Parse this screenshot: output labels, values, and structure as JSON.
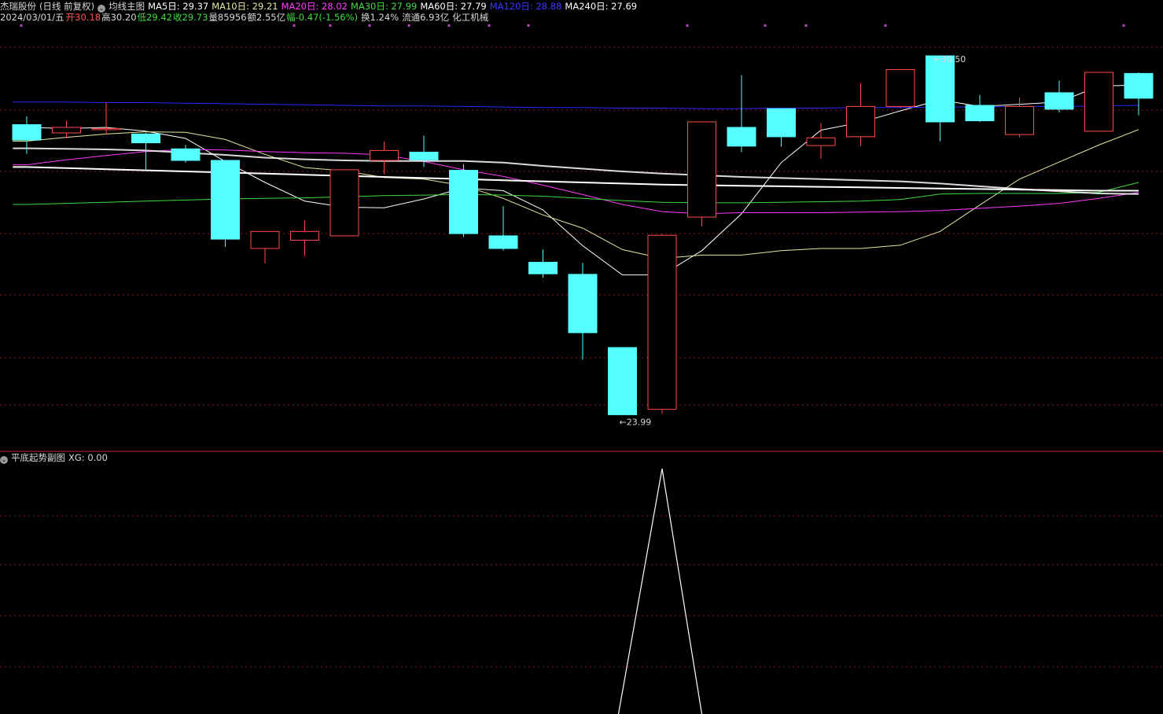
{
  "header": {
    "stock_name": "杰瑞股份",
    "period_mode": "(日线 前复权)",
    "main_indicator": "均线主图",
    "ma5": "MA5日: 29.37",
    "ma10": "MA10日: 29.21",
    "ma20": "MA20日: 28.02",
    "ma30": "MA30日: 27.99",
    "ma60": "MA60日: 27.79",
    "ma120": "MA120日: 28.88",
    "ma240": "MA240日: 27.69"
  },
  "quote": {
    "date": "2024/03/01/五",
    "open": "开30.18",
    "high": "高30.20",
    "low": "低29.42",
    "close": "收29.73",
    "volume": "量85956",
    "amount": "额2.55亿",
    "change": "幅-0.47(-1.56%)",
    "turnover": "换1.24%",
    "float_cap": "流通6.93亿",
    "industry": "化工机械"
  },
  "sub_indicator": {
    "name": "平底起势副图",
    "value": "XG: 0.00"
  },
  "colors": {
    "background": "#000000",
    "up_candle": "#ff4a4a",
    "down_candle": "#55ffff",
    "ma5": "#ffffff",
    "ma10": "#e8e8a0",
    "ma20": "#ff3cff",
    "ma30": "#3fdc3f",
    "ma60": "#ffffff",
    "ma120": "#2a2aff",
    "ma240": "#ffffff",
    "grid": "#8a1a1a",
    "separator": "#c03030",
    "marker": "#c040c0",
    "xg_line": "#ffffff"
  },
  "chart_data": [
    {
      "type": "candlestick",
      "name": "main",
      "ylim": [
        23.8,
        31.0
      ],
      "high_label": "30.50",
      "low_label": "23.99",
      "high_index": 23,
      "low_index": 15,
      "candles": [
        {
          "o": 29.25,
          "h": 29.4,
          "l": 28.72,
          "c": 28.97
        },
        {
          "o": 29.1,
          "h": 29.32,
          "l": 29.0,
          "c": 29.2
        },
        {
          "o": 29.18,
          "h": 29.65,
          "l": 29.07,
          "c": 29.18
        },
        {
          "o": 29.08,
          "h": 29.1,
          "l": 28.41,
          "c": 28.92
        },
        {
          "o": 28.81,
          "h": 28.88,
          "l": 28.56,
          "c": 28.6
        },
        {
          "o": 28.6,
          "h": 28.6,
          "l": 27.03,
          "c": 27.17
        },
        {
          "o": 27.0,
          "h": 27.15,
          "l": 26.73,
          "c": 27.31
        },
        {
          "o": 27.15,
          "h": 27.51,
          "l": 26.87,
          "c": 27.31
        },
        {
          "o": 27.23,
          "h": 28.43,
          "l": 27.23,
          "c": 28.43
        },
        {
          "o": 28.6,
          "h": 28.94,
          "l": 28.35,
          "c": 28.78
        },
        {
          "o": 28.75,
          "h": 29.05,
          "l": 28.48,
          "c": 28.61
        },
        {
          "o": 28.42,
          "h": 28.53,
          "l": 27.21,
          "c": 27.27
        },
        {
          "o": 27.23,
          "h": 27.77,
          "l": 26.96,
          "c": 27.0
        },
        {
          "o": 26.75,
          "h": 26.98,
          "l": 26.47,
          "c": 26.54
        },
        {
          "o": 26.53,
          "h": 26.74,
          "l": 24.98,
          "c": 25.47
        },
        {
          "o": 25.2,
          "h": 25.2,
          "l": 23.99,
          "c": 23.98
        },
        {
          "o": 24.08,
          "h": 27.26,
          "l": 24.0,
          "c": 27.24
        },
        {
          "o": 27.57,
          "h": 29.3,
          "l": 27.4,
          "c": 29.3
        },
        {
          "o": 29.2,
          "h": 30.15,
          "l": 28.75,
          "c": 28.86
        },
        {
          "o": 29.54,
          "h": 29.54,
          "l": 28.85,
          "c": 29.03
        },
        {
          "o": 28.87,
          "h": 29.28,
          "l": 28.63,
          "c": 29.01
        },
        {
          "o": 29.03,
          "h": 30.0,
          "l": 28.86,
          "c": 29.58
        },
        {
          "o": 29.58,
          "h": 30.25,
          "l": 29.55,
          "c": 30.25
        },
        {
          "o": 30.5,
          "h": 30.5,
          "l": 28.95,
          "c": 29.3
        },
        {
          "o": 29.6,
          "h": 29.79,
          "l": 29.3,
          "c": 29.32
        },
        {
          "o": 29.07,
          "h": 29.74,
          "l": 29.02,
          "c": 29.58
        },
        {
          "o": 29.83,
          "h": 30.05,
          "l": 29.47,
          "c": 29.53
        },
        {
          "o": 29.13,
          "h": 30.2,
          "l": 29.13,
          "c": 30.2
        },
        {
          "o": 30.18,
          "h": 30.2,
          "l": 29.42,
          "c": 29.73
        }
      ],
      "series": [
        {
          "name": "MA5",
          "color_key": "ma5",
          "values": [
            29.2,
            29.18,
            29.2,
            29.13,
            29.0,
            28.58,
            28.2,
            27.86,
            27.75,
            27.74,
            27.9,
            28.1,
            28.05,
            27.7,
            27.05,
            26.52,
            26.52,
            26.96,
            27.63,
            28.56,
            29.15,
            29.29,
            29.5,
            29.7,
            29.58,
            29.62,
            29.66,
            29.95,
            29.97
          ]
        },
        {
          "name": "MA10",
          "color_key": "ma10",
          "values": [
            28.95,
            29.02,
            29.08,
            29.12,
            29.11,
            28.98,
            28.71,
            28.47,
            28.41,
            28.29,
            28.26,
            28.14,
            27.91,
            27.61,
            27.37,
            26.98,
            26.82,
            26.88,
            26.88,
            26.96,
            27.0,
            27.0,
            27.06,
            27.31,
            27.79,
            28.26,
            28.57,
            28.88,
            29.16
          ]
        },
        {
          "name": "MA20",
          "color_key": "ma20",
          "values": [
            28.52,
            28.61,
            28.69,
            28.76,
            28.8,
            28.79,
            28.76,
            28.74,
            28.73,
            28.7,
            28.58,
            28.43,
            28.31,
            28.15,
            27.98,
            27.8,
            27.67,
            27.63,
            27.65,
            27.65,
            27.65,
            27.66,
            27.67,
            27.69,
            27.73,
            27.77,
            27.82,
            27.91,
            28.02
          ]
        },
        {
          "name": "MA30",
          "color_key": "ma30",
          "values": [
            27.8,
            27.82,
            27.84,
            27.86,
            27.88,
            27.9,
            27.91,
            27.92,
            27.94,
            27.96,
            27.97,
            27.98,
            27.97,
            27.95,
            27.91,
            27.87,
            27.84,
            27.83,
            27.83,
            27.84,
            27.85,
            27.86,
            27.89,
            27.99,
            28.0,
            28.0,
            28.0,
            28.02,
            28.2
          ]
        },
        {
          "name": "MA60",
          "color_key": "ma60",
          "values": [
            28.82,
            28.81,
            28.8,
            28.78,
            28.74,
            28.7,
            28.65,
            28.62,
            28.6,
            28.59,
            28.59,
            28.59,
            28.56,
            28.5,
            28.45,
            28.4,
            28.36,
            28.33,
            28.3,
            28.28,
            28.26,
            28.24,
            28.22,
            28.18,
            28.13,
            28.08,
            28.04,
            28.0,
            27.99
          ]
        },
        {
          "name": "MA120",
          "color_key": "ma120",
          "values": [
            29.66,
            29.66,
            29.65,
            29.65,
            29.64,
            29.63,
            29.62,
            29.61,
            29.6,
            29.59,
            29.59,
            29.58,
            29.57,
            29.56,
            29.56,
            29.55,
            29.55,
            29.54,
            29.54,
            29.55,
            29.55,
            29.56,
            29.56,
            29.57,
            29.57,
            29.58,
            29.58,
            29.59,
            29.6
          ]
        },
        {
          "name": "MA240",
          "color_key": "ma240",
          "values": [
            28.48,
            28.46,
            28.44,
            28.42,
            28.4,
            28.38,
            28.36,
            28.34,
            28.32,
            28.3,
            28.28,
            28.26,
            28.24,
            28.22,
            28.2,
            28.18,
            28.16,
            28.15,
            28.14,
            28.13,
            28.12,
            28.11,
            28.1,
            28.09,
            28.08,
            28.07,
            28.06,
            28.05,
            28.05
          ]
        }
      ]
    },
    {
      "type": "line",
      "name": "XG",
      "ylim": [
        0,
        1
      ],
      "x_indices": [
        14.9,
        16.0,
        17.0
      ],
      "values": [
        0,
        1,
        0
      ]
    }
  ]
}
